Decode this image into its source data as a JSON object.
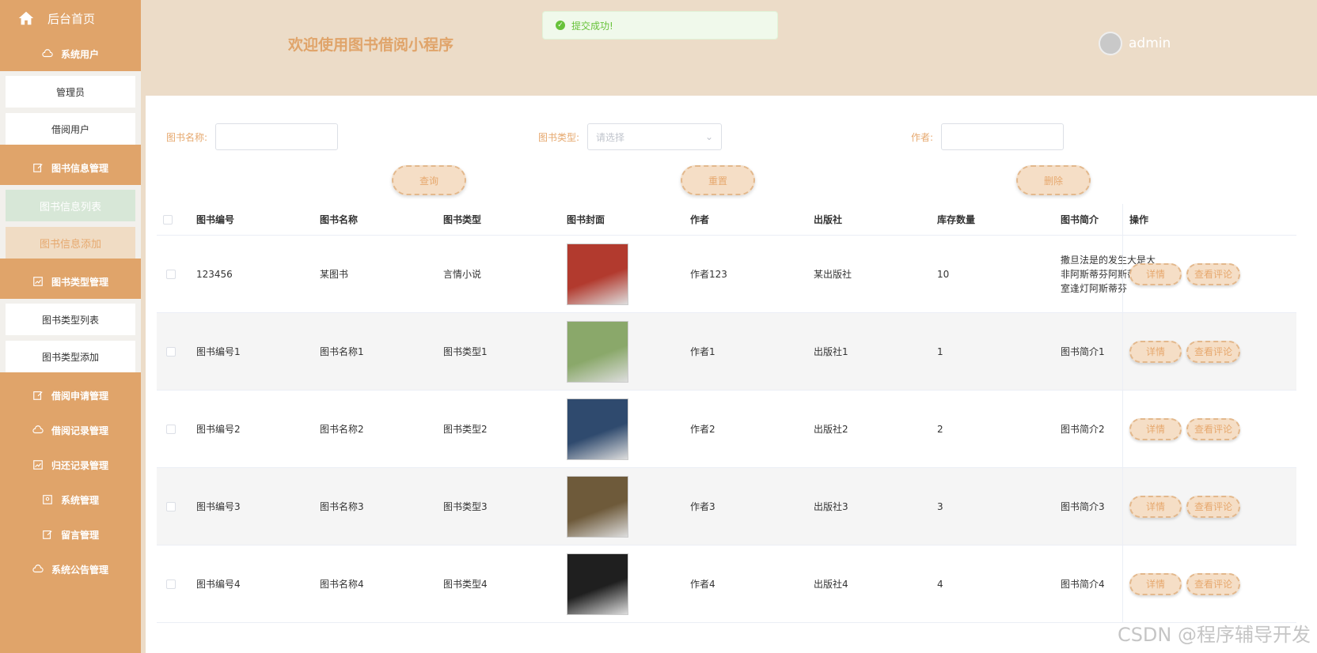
{
  "sidebar": {
    "home": "后台首页",
    "groups": [
      {
        "label": "系统用户",
        "items": [
          "管理员",
          "借阅用户"
        ]
      },
      {
        "label": "图书信息管理",
        "items": [
          "图书信息列表",
          "图书信息添加"
        ]
      },
      {
        "label": "图书类型管理",
        "items": [
          "图书类型列表",
          "图书类型添加"
        ]
      },
      {
        "label": "借阅申请管理"
      },
      {
        "label": "借阅记录管理"
      },
      {
        "label": "归还记录管理"
      },
      {
        "label": "系统管理"
      },
      {
        "label": "留言管理"
      },
      {
        "label": "系统公告管理"
      }
    ]
  },
  "header": {
    "title": "欢迎使用图书借阅小程序",
    "user": "admin",
    "toast": "提交成功!"
  },
  "filters": {
    "name_label": "图书名称:",
    "type_label": "图书类型:",
    "type_placeholder": "请选择",
    "author_label": "作者:",
    "query": "查询",
    "reset": "重置",
    "delete": "删除"
  },
  "table": {
    "headers": [
      "图书编号",
      "图书名称",
      "图书类型",
      "图书封面",
      "作者",
      "出版社",
      "库存数量",
      "图书简介",
      "操作"
    ],
    "detail": "详情",
    "comments": "查看评论",
    "rows": [
      {
        "id": "123456",
        "name": "某图书",
        "type": "言情小说",
        "author": "作者123",
        "publisher": "某出版社",
        "stock": "10",
        "intro": "撒旦法是的发生大是大非阿斯蒂芬阿斯蒂芬暗室逢灯阿斯蒂芬",
        "cover_color": "#b23a2e"
      },
      {
        "id": "图书编号1",
        "name": "图书名称1",
        "type": "图书类型1",
        "author": "作者1",
        "publisher": "出版社1",
        "stock": "1",
        "intro": "图书简介1",
        "cover_color": "#8aa86a"
      },
      {
        "id": "图书编号2",
        "name": "图书名称2",
        "type": "图书类型2",
        "author": "作者2",
        "publisher": "出版社2",
        "stock": "2",
        "intro": "图书简介2",
        "cover_color": "#2f4a6e"
      },
      {
        "id": "图书编号3",
        "name": "图书名称3",
        "type": "图书类型3",
        "author": "作者3",
        "publisher": "出版社3",
        "stock": "3",
        "intro": "图书简介3",
        "cover_color": "#6e5a3a"
      },
      {
        "id": "图书编号4",
        "name": "图书名称4",
        "type": "图书类型4",
        "author": "作者4",
        "publisher": "出版社4",
        "stock": "4",
        "intro": "图书简介4",
        "cover_color": "#1f1f1f"
      }
    ]
  },
  "watermark": "CSDN @程序辅导开发"
}
